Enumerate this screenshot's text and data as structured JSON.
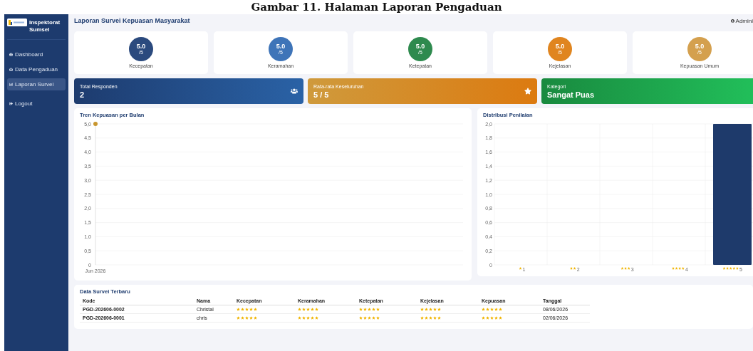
{
  "caption": "Gambar 11. Halaman Laporan Pengaduan",
  "sidebar": {
    "brand": "Inspektorat Sumsel",
    "items": [
      {
        "label": "Dashboard",
        "kind": "dashboard",
        "selected": false
      },
      {
        "label": "Data Pengaduan",
        "kind": "inbox",
        "selected": false
      },
      {
        "label": "Laporan Survei",
        "kind": "report",
        "selected": true
      },
      {
        "label": "Logout",
        "kind": "logout",
        "selected": false
      }
    ]
  },
  "header": {
    "title": "Laporan Survei Kepuasan Masyarakat",
    "user": "Admini"
  },
  "ratings": [
    {
      "score": "5.0",
      "max": "/5",
      "label": "Kecepatan",
      "color": "#2b4a7e"
    },
    {
      "score": "5.0",
      "max": "/5",
      "label": "Keramahan",
      "color": "#3e74b8"
    },
    {
      "score": "5.0",
      "max": "/5",
      "label": "Ketepatan",
      "color": "#2e8a4e"
    },
    {
      "score": "5.0",
      "max": "/5",
      "label": "Kejelasan",
      "color": "#e0851f"
    },
    {
      "score": "5.0",
      "max": "/5",
      "label": "Kepuasan Umum",
      "color": "#d4a04e"
    }
  ],
  "stats": [
    {
      "label": "Total Responden",
      "value": "2",
      "kind": "people"
    },
    {
      "label": "Rata-rata Keseluruhan",
      "value": "5 / 5",
      "kind": "star"
    },
    {
      "label": "Kategori",
      "value": "Sangat Puas",
      "kind": "category"
    }
  ],
  "trend": {
    "title": "Tren Kepuasan per Bulan",
    "chart_data": {
      "type": "line",
      "x": [
        "Jun 2026"
      ],
      "series": [
        {
          "color": "#c8962e",
          "marker": "circle",
          "values": [
            5.0
          ]
        }
      ],
      "ylim": [
        0,
        5
      ],
      "grid": true,
      "yticks": [
        0,
        {
          "value": 0.5,
          "label": "0,5"
        },
        {
          "value": 1,
          "label": "1,0"
        },
        {
          "value": 1.5,
          "label": "1,5"
        },
        {
          "value": 2,
          "label": "2,0"
        },
        {
          "value": 2.5,
          "label": "2,5"
        },
        {
          "value": 3,
          "label": "3,0"
        },
        {
          "value": 3.5,
          "label": "3,5"
        },
        {
          "value": 4,
          "label": "4,0"
        },
        {
          "value": 4.5,
          "label": "4,5"
        },
        {
          "value": 5,
          "label": "5,0"
        }
      ]
    }
  },
  "distribution": {
    "title": "Distribusi Penilaian",
    "chart_data": {
      "type": "bar",
      "categories": [
        "1",
        "2",
        "3",
        "4",
        "5"
      ],
      "series": [
        {
          "color": "#1e3a6b",
          "values": [
            0,
            0,
            0,
            0,
            2
          ]
        }
      ],
      "ylim": [
        0,
        2
      ],
      "grid": true,
      "yticks": [
        0,
        {
          "value": 0.2,
          "label": "0,2"
        },
        {
          "value": 0.4,
          "label": "0,4"
        },
        {
          "value": 0.6,
          "label": "0,6"
        },
        {
          "value": 0.8,
          "label": "0,8"
        },
        {
          "value": 1,
          "label": "1,0"
        },
        {
          "value": 1.2,
          "label": "1,2"
        },
        {
          "value": 1.4,
          "label": "1,4"
        },
        {
          "value": 1.6,
          "label": "1,6"
        },
        {
          "value": 1.8,
          "label": "1,8"
        },
        {
          "value": 2,
          "label": "2,0"
        }
      ]
    }
  },
  "table": {
    "title": "Data Survei Terbaru",
    "columns": [
      "Kode",
      "Nama",
      "Kecepatan",
      "Keramahan",
      "Ketepatan",
      "Kejelasan",
      "Kepuasan",
      "Tanggal"
    ],
    "rows": [
      {
        "code": "PGD-202606-0002",
        "name": "Christal",
        "ratings": [
          {
            "stars": 5
          },
          {
            "stars": 5
          },
          {
            "stars": 5
          },
          {
            "stars": 5
          },
          {
            "stars": 5
          }
        ],
        "date": "08/06/2026"
      },
      {
        "code": "PGD-202606-0001",
        "name": "chris",
        "ratings": [
          {
            "stars": 5
          },
          {
            "stars": 5
          },
          {
            "stars": 5
          },
          {
            "stars": 5
          },
          {
            "stars": 5
          }
        ],
        "date": "02/06/2026"
      }
    ]
  }
}
